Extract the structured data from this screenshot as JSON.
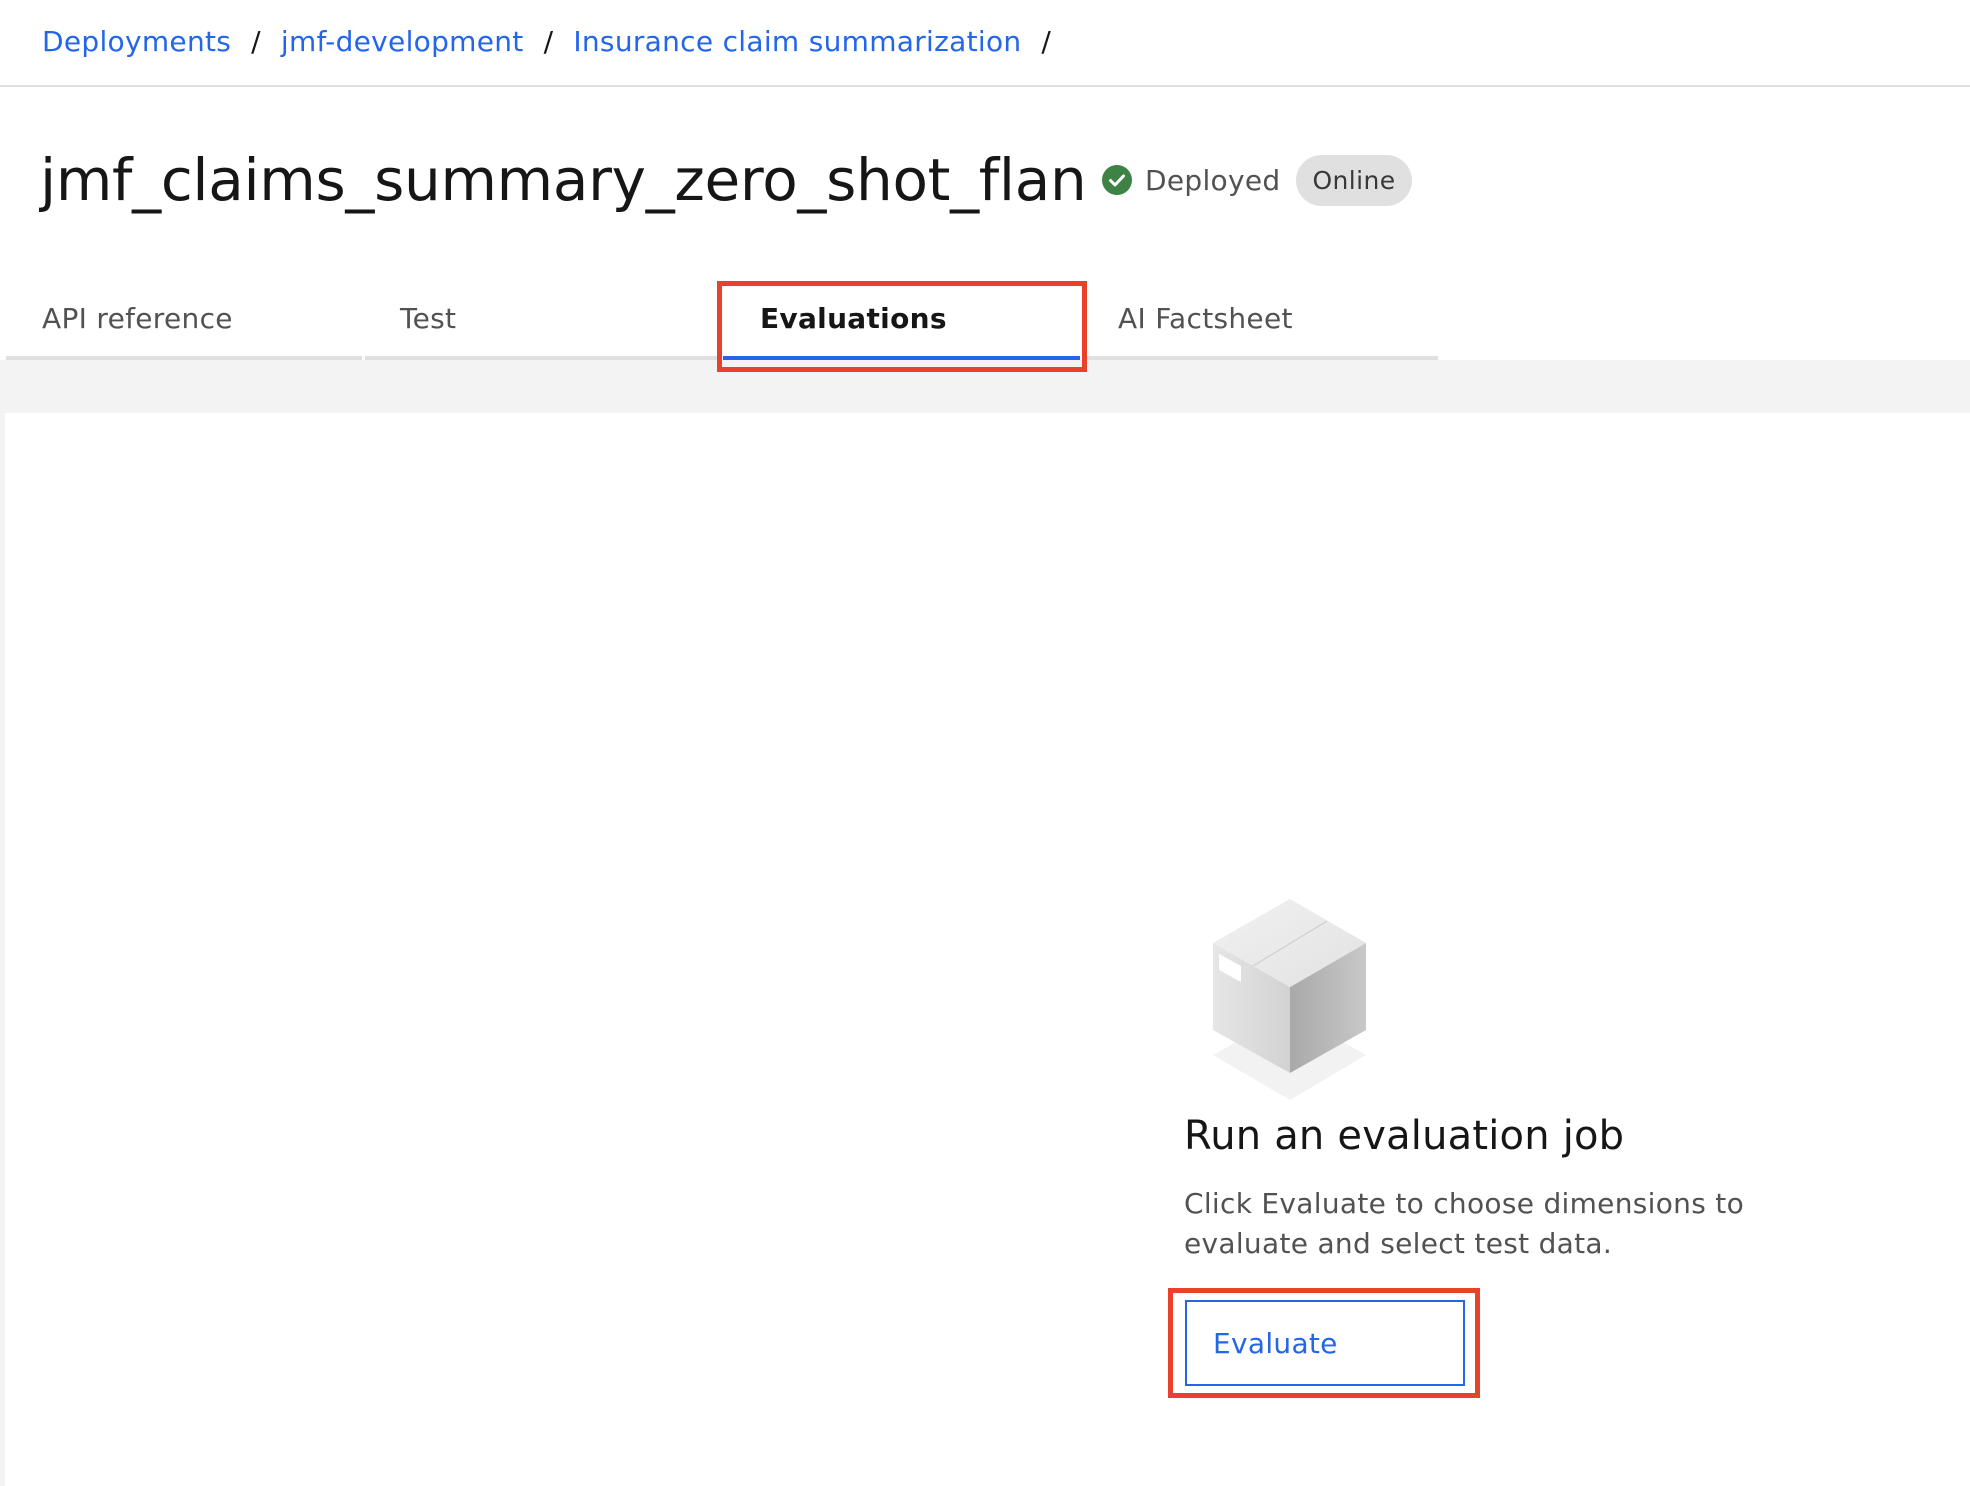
{
  "breadcrumb": {
    "items": [
      {
        "label": "Deployments"
      },
      {
        "label": "jmf-development"
      },
      {
        "label": "Insurance claim summarization"
      }
    ],
    "separator": "/"
  },
  "header": {
    "title": "jmf_claims_summary_zero_shot_flan",
    "status": {
      "icon": "checkmark-filled-icon",
      "label": "Deployed",
      "color": "#3e8345"
    },
    "badge": "Online"
  },
  "tabs": [
    {
      "label": "API reference",
      "active": false
    },
    {
      "label": "Test",
      "active": false
    },
    {
      "label": "Evaluations",
      "active": true
    },
    {
      "label": "AI Factsheet",
      "active": false
    }
  ],
  "empty_state": {
    "illustration": "cardboard-box-icon",
    "title": "Run an evaluation job",
    "description": "Click Evaluate to choose dimensions to evaluate and select test data.",
    "button_label": "Evaluate"
  },
  "colors": {
    "accent": "#2466ea",
    "highlight": "#e8412c",
    "success": "#3e8345"
  }
}
